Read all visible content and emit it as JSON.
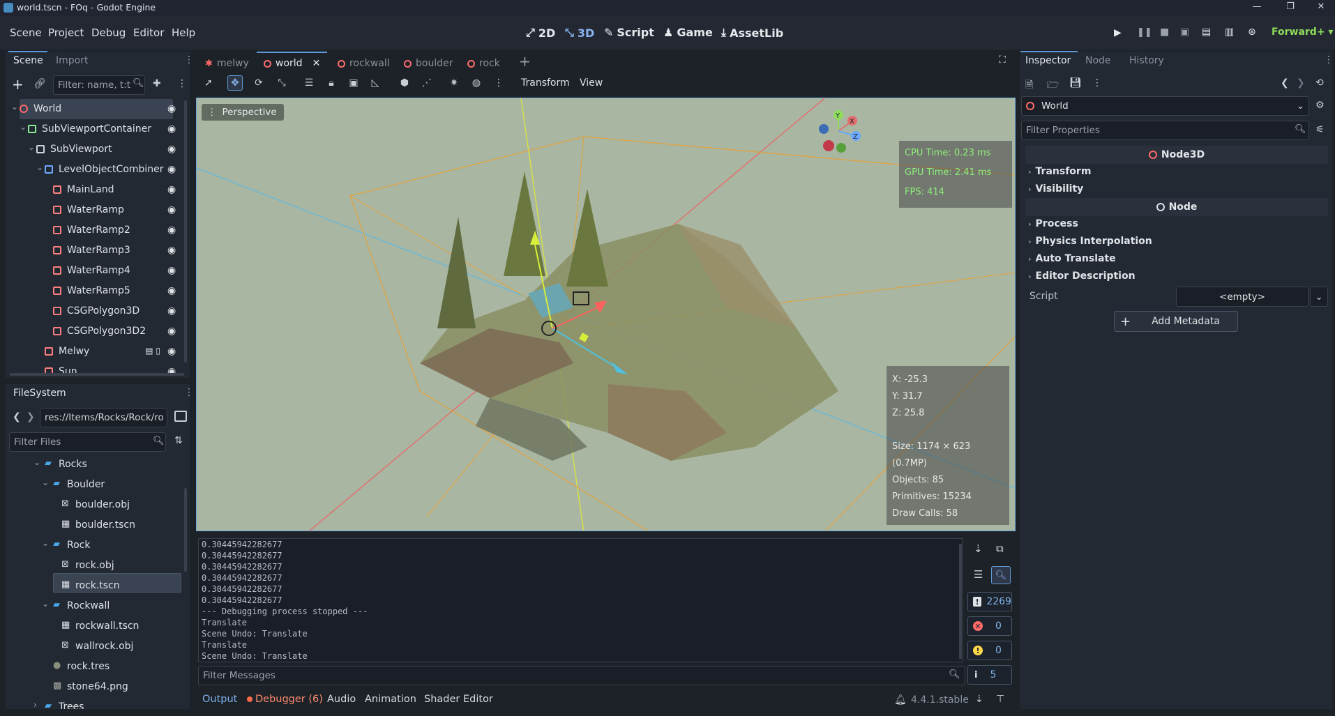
{
  "window": {
    "title": "world.tscn - FOq - Godot Engine"
  },
  "menu": {
    "items": [
      "Scene",
      "Project",
      "Debug",
      "Editor",
      "Help"
    ],
    "workspaces": [
      "2D",
      "3D",
      "Script",
      "Game",
      "AssetLib"
    ],
    "renderer": "Forward+"
  },
  "scene_dock": {
    "tabs": [
      "Scene",
      "Import"
    ],
    "filter_placeholder": "Filter: name, t:t",
    "nodes": [
      {
        "name": "World",
        "depth": 0,
        "icon": "node3d-icon",
        "color": "#ff6b6b"
      },
      {
        "name": "SubViewportContainer",
        "depth": 1,
        "icon": "control-icon",
        "color": "#8eef97"
      },
      {
        "name": "SubViewport",
        "depth": 2,
        "icon": "viewport-icon",
        "color": "#d0d4da"
      },
      {
        "name": "LevelObjectCombiner",
        "depth": 3,
        "icon": "csg-combiner-icon",
        "color": "#6fa8ff"
      },
      {
        "name": "MainLand",
        "depth": 4,
        "icon": "csg-icon",
        "color": "#fc7f7f"
      },
      {
        "name": "WaterRamp",
        "depth": 4,
        "icon": "csg-icon",
        "color": "#fc7f7f"
      },
      {
        "name": "WaterRamp2",
        "depth": 4,
        "icon": "csg-icon",
        "color": "#fc7f7f"
      },
      {
        "name": "WaterRamp3",
        "depth": 4,
        "icon": "csg-icon",
        "color": "#fc7f7f"
      },
      {
        "name": "WaterRamp4",
        "depth": 4,
        "icon": "csg-icon",
        "color": "#fc7f7f"
      },
      {
        "name": "WaterRamp5",
        "depth": 4,
        "icon": "csg-icon",
        "color": "#fc7f7f"
      },
      {
        "name": "CSGPolygon3D",
        "depth": 4,
        "icon": "csg-icon",
        "color": "#fc7f7f"
      },
      {
        "name": "CSGPolygon3D2",
        "depth": 4,
        "icon": "csg-icon",
        "color": "#fc7f7f"
      },
      {
        "name": "Melwy",
        "depth": 3,
        "icon": "character-icon",
        "color": "#fc7f7f"
      },
      {
        "name": "Sun",
        "depth": 3,
        "icon": "light-icon",
        "color": "#fc7f7f"
      }
    ]
  },
  "filesystem": {
    "title": "FileSystem",
    "path": "res://Items/Rocks/Rock/ro",
    "filter_placeholder": "Filter Files",
    "items": [
      {
        "name": "Rocks",
        "depth": 1,
        "kind": "folder",
        "open": true
      },
      {
        "name": "Boulder",
        "depth": 2,
        "kind": "folder",
        "open": true
      },
      {
        "name": "boulder.obj",
        "depth": 3,
        "kind": "mesh"
      },
      {
        "name": "boulder.tscn",
        "depth": 3,
        "kind": "scene"
      },
      {
        "name": "Rock",
        "depth": 2,
        "kind": "folder",
        "open": true
      },
      {
        "name": "rock.obj",
        "depth": 3,
        "kind": "mesh"
      },
      {
        "name": "rock.tscn",
        "depth": 3,
        "kind": "scene",
        "selected": true
      },
      {
        "name": "Rockwall",
        "depth": 2,
        "kind": "folder",
        "open": true
      },
      {
        "name": "rockwall.tscn",
        "depth": 3,
        "kind": "scene"
      },
      {
        "name": "wallrock.obj",
        "depth": 3,
        "kind": "mesh"
      },
      {
        "name": "rock.tres",
        "depth": 2,
        "kind": "resource"
      },
      {
        "name": "stone64.png",
        "depth": 2,
        "kind": "image"
      },
      {
        "name": "Trees",
        "depth": 1,
        "kind": "folder",
        "open": false
      }
    ]
  },
  "editor_tabs": [
    {
      "name": "melwy",
      "active": false
    },
    {
      "name": "world",
      "active": true
    },
    {
      "name": "rockwall",
      "active": false
    },
    {
      "name": "boulder",
      "active": false
    },
    {
      "name": "rock",
      "active": false
    }
  ],
  "viewport": {
    "toolbar_menus": [
      "Transform",
      "View"
    ],
    "perspective_label": "Perspective",
    "perf": [
      "CPU Time: 0.23 ms",
      "GPU Time: 2.41 ms",
      "FPS: 414"
    ],
    "stats": [
      "X: -25.3",
      "Y: 31.7",
      "Z: 25.8",
      "",
      "Size: 1174 × 623 (0.7MP)",
      "",
      "Objects: 85",
      "Primitives: 15234",
      "Draw Calls: 58"
    ],
    "gizmo_labels": [
      "Y",
      "X",
      "Z"
    ]
  },
  "output": {
    "lines": [
      "0.30445942282677",
      "0.30445942282677",
      "0.30445942282677",
      "0.30445942282677",
      "0.30445942282677",
      "0.30445942282677",
      "--- Debugging process stopped ---",
      "Translate",
      "Scene Undo: Translate",
      "Translate",
      "Scene Undo: Translate"
    ],
    "filter_placeholder": "Filter Messages",
    "counts": {
      "messages": "2269",
      "errors": "0",
      "warnings": "0",
      "info": "5"
    }
  },
  "bottom_tabs": [
    "Output",
    "Debugger (6)",
    "Audio",
    "Animation",
    "Shader Editor"
  ],
  "version": "4.4.1.stable",
  "inspector": {
    "tabs": [
      "Inspector",
      "Node",
      "History"
    ],
    "object_name": "World",
    "filter_placeholder": "Filter Properties",
    "sections": [
      {
        "title": "Node3D",
        "props": [
          "Transform",
          "Visibility"
        ]
      },
      {
        "title": "Node",
        "props": [
          "Process",
          "Physics Interpolation",
          "Auto Translate",
          "Editor Description"
        ]
      }
    ],
    "script_label": "Script",
    "script_value": "<empty>",
    "add_metadata": "Add Metadata"
  },
  "colors": {
    "accent": "#5e9bd6",
    "panel": "#232933",
    "viewport_bg": "#a9b7a2",
    "perf_text": "#8fef7a",
    "error": "#ff6b6b",
    "warning": "#ffd84a"
  }
}
